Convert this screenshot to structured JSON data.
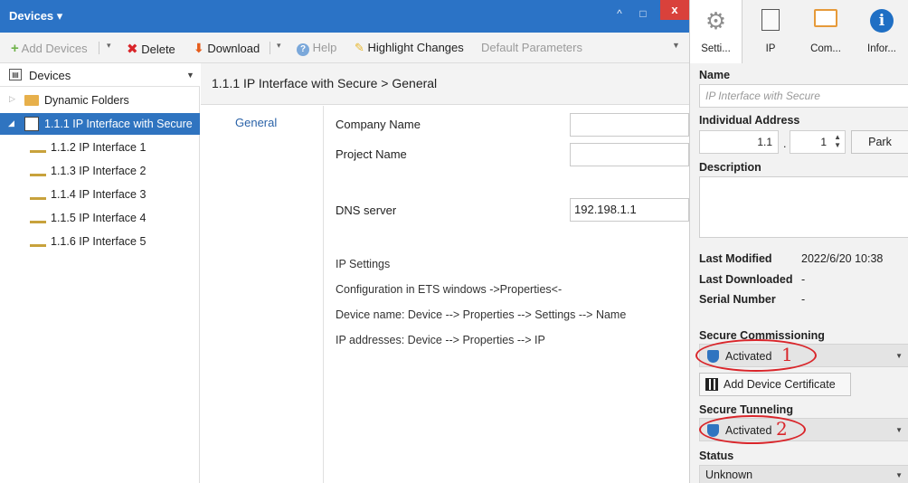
{
  "window": {
    "title": "Devices",
    "controls": {
      "collapse": "^",
      "restore": "□",
      "close": "x"
    }
  },
  "toolbar": {
    "add_devices": "Add Devices",
    "delete": "Delete",
    "download": "Download",
    "help": "Help",
    "highlight_changes": "Highlight Changes",
    "default_parameters": "Default Parameters"
  },
  "tree": {
    "header": "Devices",
    "items": [
      {
        "label": "Dynamic Folders"
      },
      {
        "label": "1.1.1 IP Interface with Secure"
      },
      {
        "label": "1.1.2 IP Interface 1"
      },
      {
        "label": "1.1.3 IP Interface 2"
      },
      {
        "label": "1.1.4 IP Interface 3"
      },
      {
        "label": "1.1.5 IP Interface 4"
      },
      {
        "label": "1.1.6 IP Interface 5"
      }
    ]
  },
  "content": {
    "breadcrumb": "1.1.1 IP Interface with Secure > General",
    "tab": "General",
    "fields": {
      "company_name_label": "Company Name",
      "company_name_value": "",
      "project_name_label": "Project Name",
      "project_name_value": "",
      "dns_label": "DNS server",
      "dns_value": "192.198.1.1"
    },
    "info": [
      "IP Settings",
      "Configuration in ETS windows ->Properties<-",
      "Device name:  Device --> Properties --> Settings --> Name",
      "IP addresses: Device --> Properties --> IP"
    ]
  },
  "properties": {
    "tabs": [
      {
        "label": "Setti..."
      },
      {
        "label": "IP"
      },
      {
        "label": "Com..."
      },
      {
        "label": "Infor..."
      }
    ],
    "name_label": "Name",
    "name_placeholder": "IP Interface with Secure",
    "address_label": "Individual Address",
    "address_area": "1.1",
    "address_dot": ".",
    "address_device": "1",
    "park_label": "Park",
    "description_label": "Description",
    "last_modified_label": "Last Modified",
    "last_modified_value": "2022/6/20 10:38",
    "last_downloaded_label": "Last Downloaded",
    "last_downloaded_value": "-",
    "serial_label": "Serial Number",
    "serial_value": "-",
    "secure_commissioning_label": "Secure Commissioning",
    "secure_commissioning_value": "Activated",
    "annotation_1": "1",
    "add_certificate_label": "Add Device Certificate",
    "secure_tunneling_label": "Secure Tunneling",
    "secure_tunneling_value": "Activated",
    "annotation_2": "2",
    "status_label": "Status",
    "status_value": "Unknown"
  },
  "colors": {
    "accent": "#2b73c6",
    "selection": "#2f74c0",
    "annotation": "#d9252a",
    "close": "#d9413b"
  }
}
